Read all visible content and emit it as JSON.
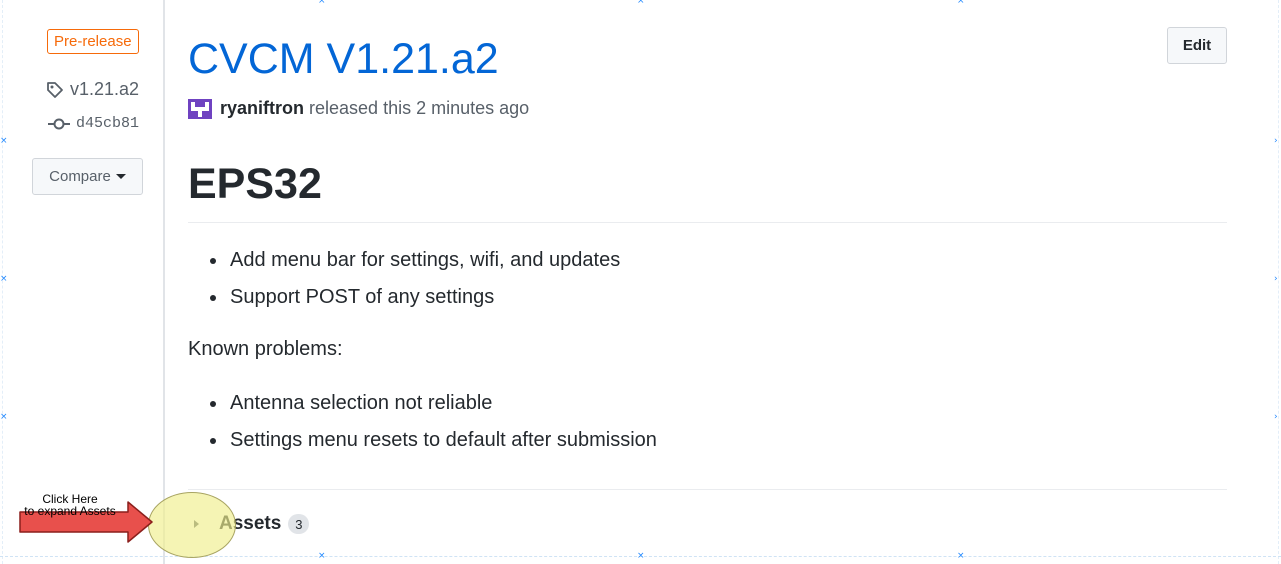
{
  "sidebar": {
    "prerelease_badge": "Pre-release",
    "tag": "v1.21.a2",
    "commit": "d45cb81",
    "compare_label": "Compare"
  },
  "release": {
    "title": "CVCM V1.21.a2",
    "edit_label": "Edit",
    "author": "ryaniftron",
    "released_text": "released this 2 minutes ago"
  },
  "body": {
    "heading": "EPS32",
    "features": [
      "Add menu bar for settings, wifi, and updates",
      "Support POST of any settings"
    ],
    "known_problems_label": "Known problems:",
    "problems": [
      "Antenna selection not reliable",
      "Settings menu resets to default after submission"
    ]
  },
  "assets": {
    "label": "Assets",
    "count": "3"
  },
  "annotation": {
    "line1": "Click Here",
    "line2": "to expand Assets"
  },
  "colors": {
    "link": "#0366d6",
    "prerelease": "#f66a0a",
    "annotation_arrow": "#e8504c",
    "annotation_highlight": "#f0ee8c"
  }
}
